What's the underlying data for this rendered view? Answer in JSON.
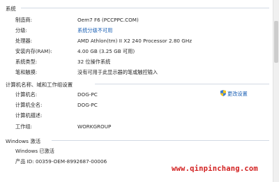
{
  "system": {
    "header": "系统",
    "rows": [
      {
        "label": "制造商:",
        "value": "Oem7 F6 (PCCPPC.COM)"
      },
      {
        "label": "分级:",
        "value": "系统分级不可用",
        "link": true
      },
      {
        "label": "处理器:",
        "value": "AMD Athlon(tm) II X2 240 Processor   2.80 GHz"
      },
      {
        "label": "安装内存(RAM):",
        "value": "4.00 GB (3.25 GB 可用)"
      },
      {
        "label": "系统类型:",
        "value": "32 位操作系统"
      },
      {
        "label": "笔和触摸:",
        "value": "没有可用于此显示器的笔或触控输入"
      }
    ]
  },
  "computer": {
    "header": "计算机名称、域和工作组设置",
    "change_settings_label": "更改设置",
    "rows": [
      {
        "label": "计算机名:",
        "value": "DOG-PC"
      },
      {
        "label": "计算机全名:",
        "value": "DOG-PC"
      },
      {
        "label": "计算机描述:",
        "value": ""
      },
      {
        "label": "工作组:",
        "value": "WORKGROUP"
      }
    ]
  },
  "activation": {
    "header": "Windows 激活",
    "status": "Windows 已激活",
    "product_id": "产品 ID: 00359-OEM-8992687-00006"
  },
  "watermark": "www.qinpinchang.com",
  "colors": {
    "link": "#1a5fb4",
    "watermark": "#d21f1f",
    "rule": "#d2d9e3"
  }
}
